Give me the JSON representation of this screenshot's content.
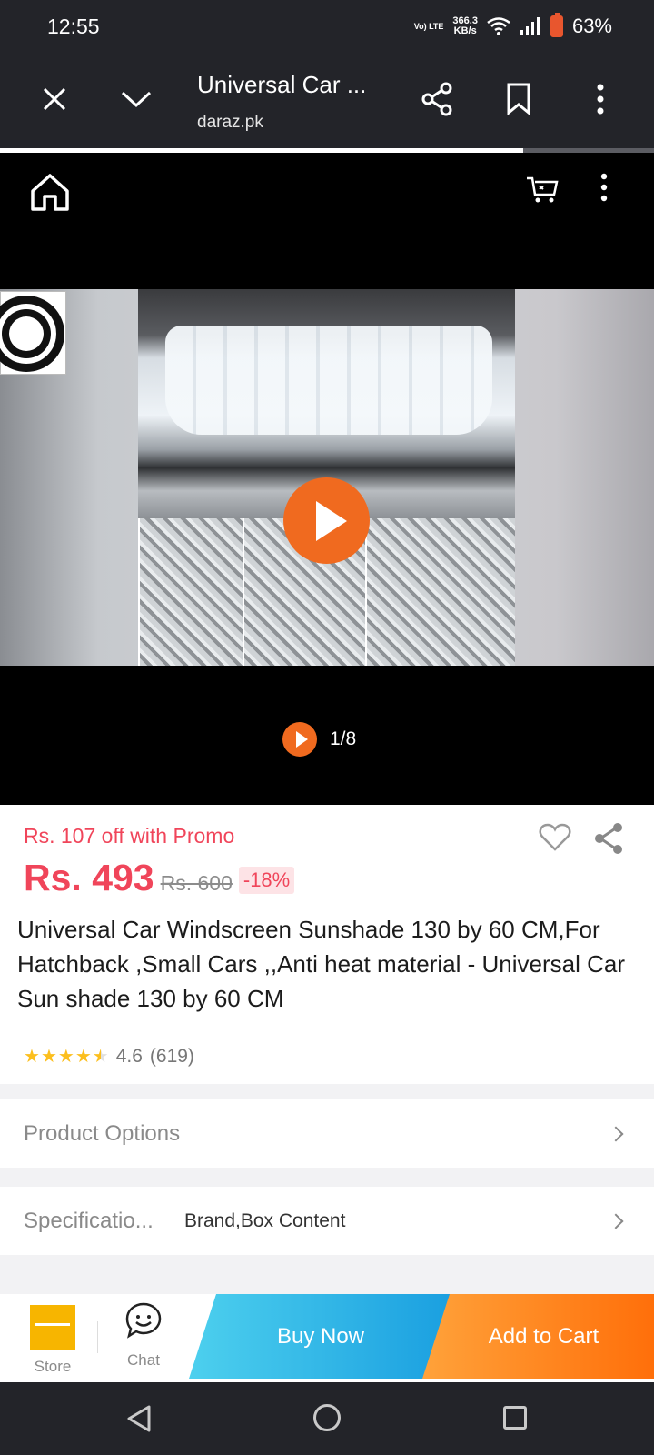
{
  "status": {
    "time": "12:55",
    "network_label": "Vo) LTE",
    "speed": "366.3",
    "speed_unit": "KB/s",
    "battery": "63%"
  },
  "browser": {
    "title": "Universal Car ...",
    "url": "daraz.pk",
    "load_progress": 0.8
  },
  "media": {
    "counter": "1/8"
  },
  "product": {
    "promo": "Rs. 107 off with Promo",
    "price": "Rs. 493",
    "old_price": "Rs. 600",
    "discount": "-18%",
    "title": "Universal Car Windscreen Sunshade 130 by 60 CM,For Hatchback ,Small Cars ,,Anti heat material - Universal Car Sun shade 130 by 60 CM",
    "rating": "4.6",
    "rating_count": "(619)",
    "stars": 4.5
  },
  "rows": {
    "options_label": "Product Options",
    "spec_label": "Specificatio...",
    "spec_value": "Brand,Box Content"
  },
  "actions": {
    "store": "Store",
    "chat": "Chat",
    "buy_now": "Buy Now",
    "add_to_cart": "Add to Cart"
  },
  "colors": {
    "accent_red": "#f0455a",
    "buy_blue": "#1a9fe0",
    "cart_orange": "#ff6f0a",
    "play_orange": "#f06a1f",
    "star": "#fcbf1e"
  }
}
